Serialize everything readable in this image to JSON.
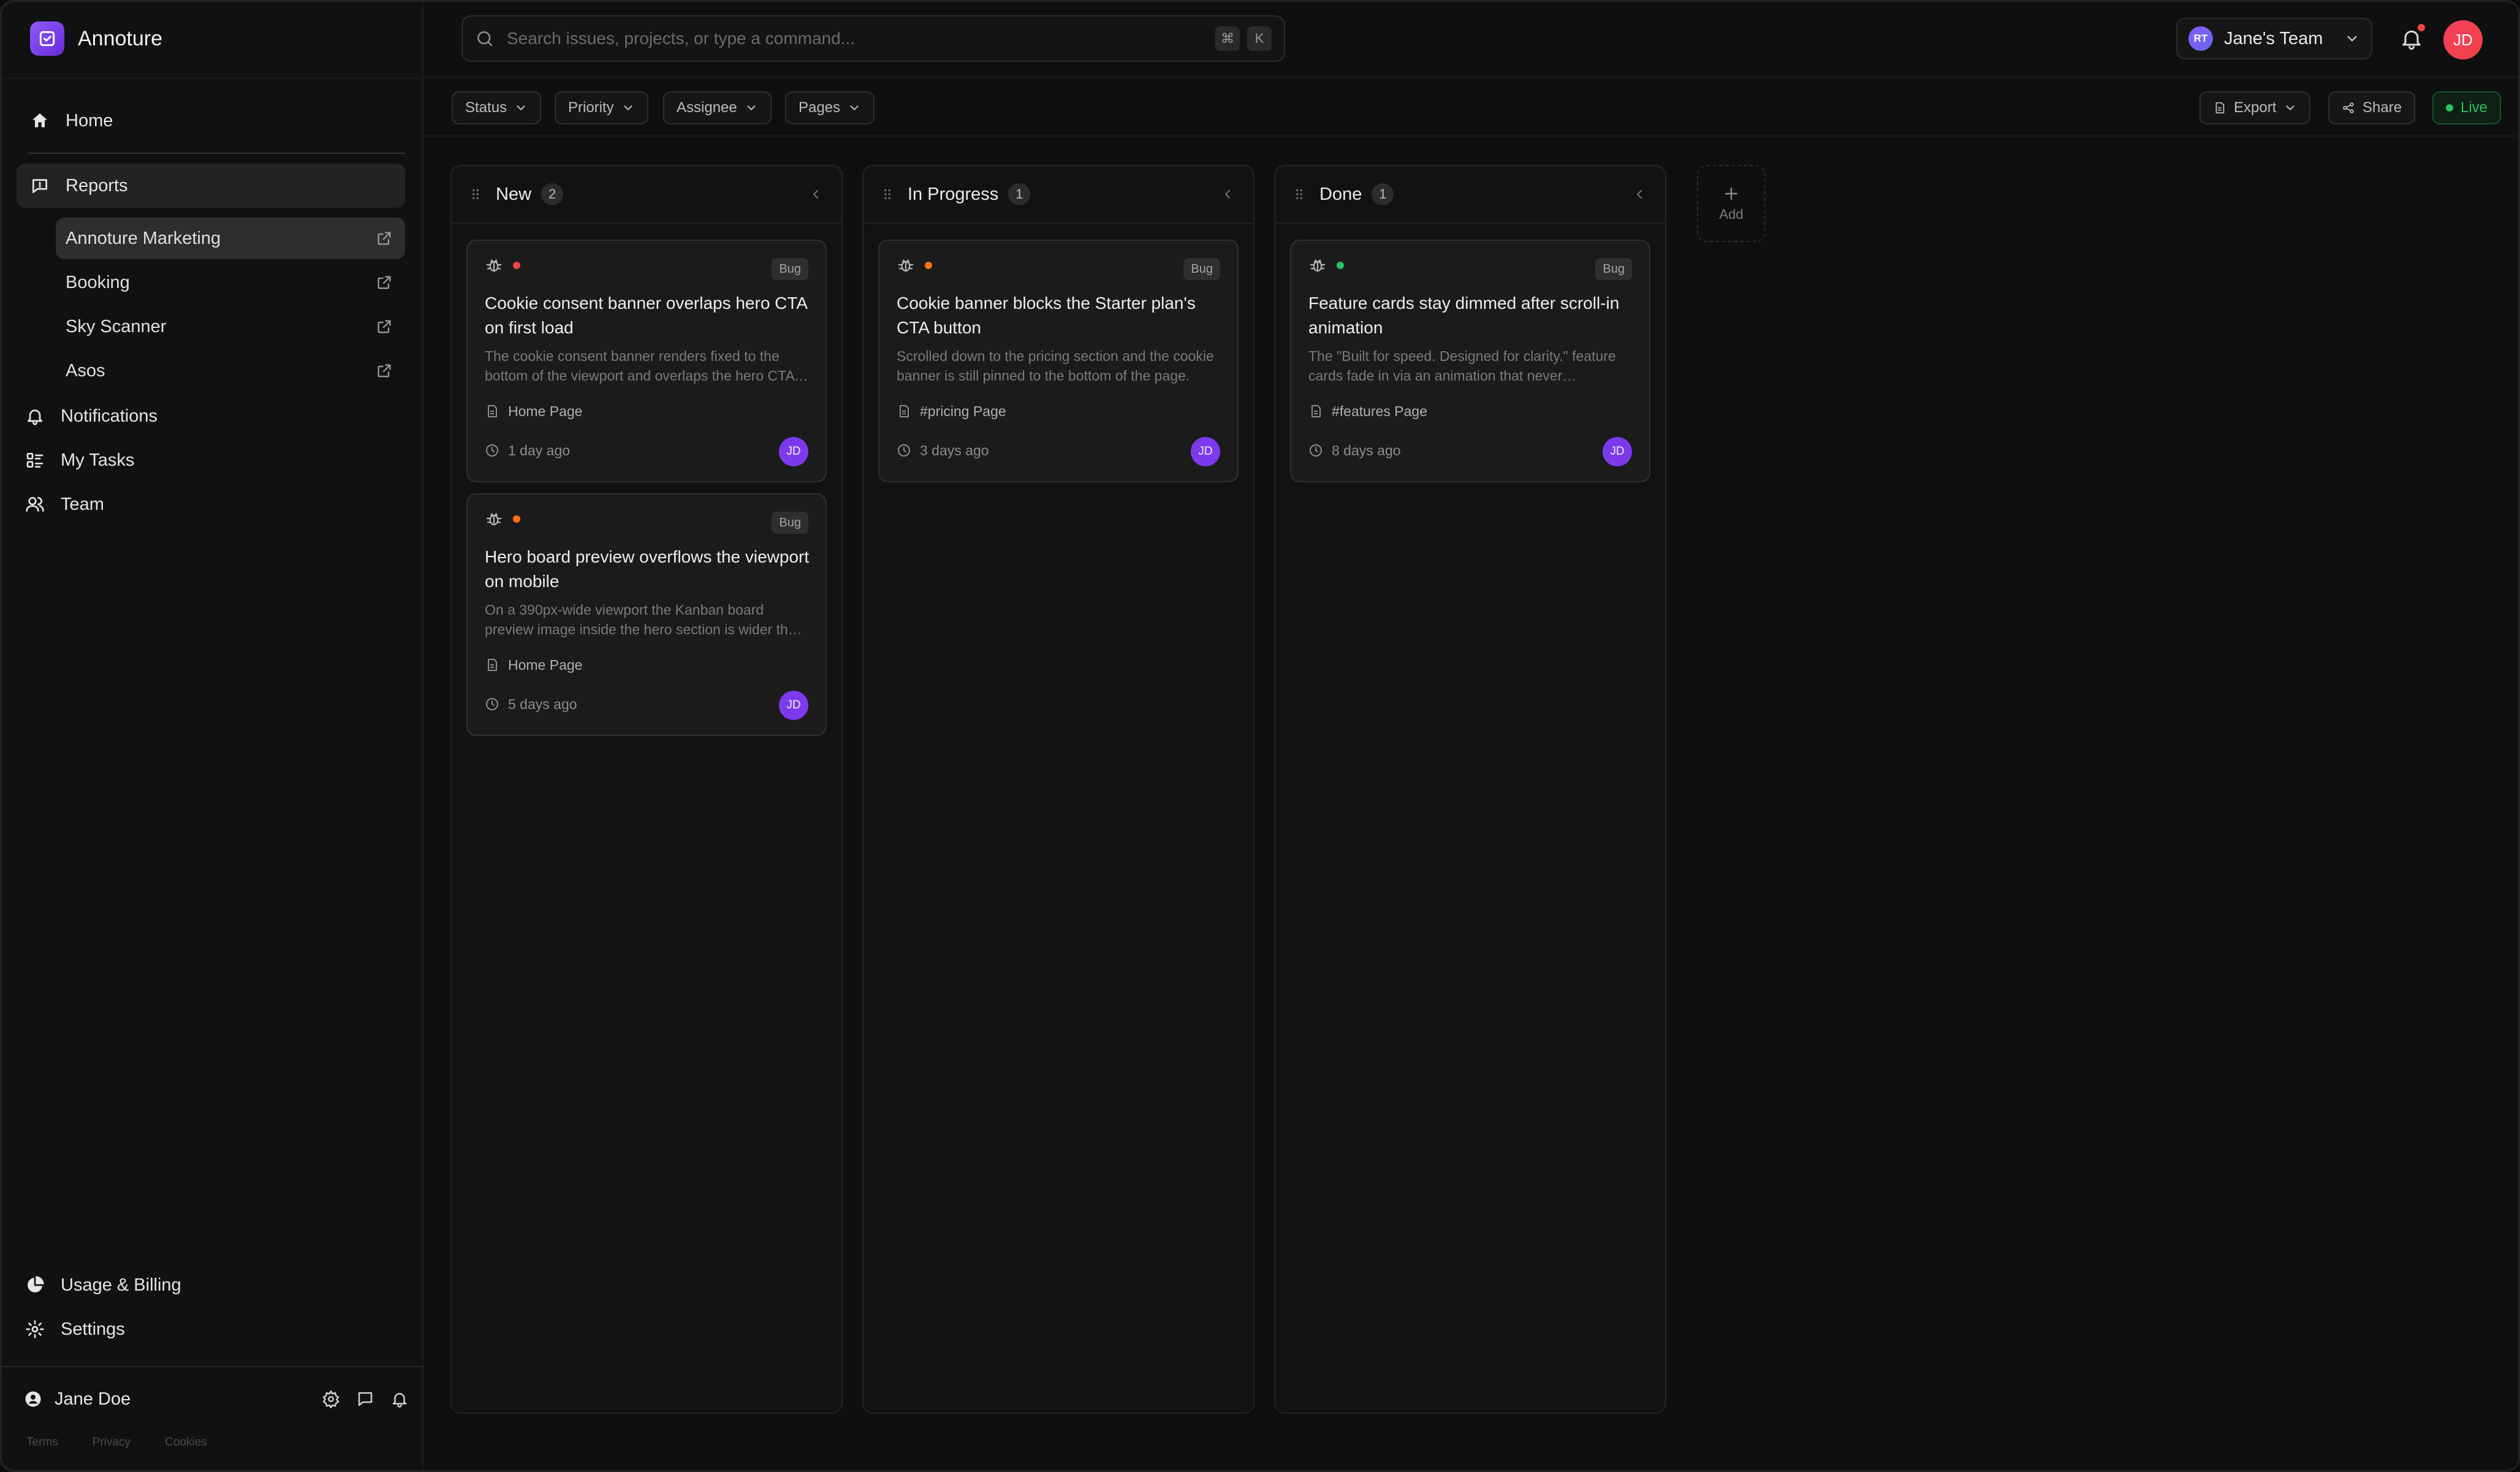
{
  "app": {
    "name": "Annoture",
    "accent": "#7c3aed"
  },
  "sidebar": {
    "home": "Home",
    "reports": "Reports",
    "reports_items": [
      {
        "label": "Annoture Marketing",
        "active": true
      },
      {
        "label": "Booking",
        "active": false
      },
      {
        "label": "Sky Scanner",
        "active": false
      },
      {
        "label": "Asos",
        "active": false
      }
    ],
    "notifications": "Notifications",
    "my_tasks": "My Tasks",
    "team": "Team",
    "usage_billing": "Usage & Billing",
    "settings": "Settings",
    "user": {
      "name": "Jane Doe"
    },
    "legal": {
      "terms": "Terms",
      "privacy": "Privacy",
      "cookies": "Cookies"
    }
  },
  "topbar": {
    "search_placeholder": "Search issues, projects, or type a command...",
    "shortcut": {
      "mod": "⌘",
      "key": "K"
    },
    "team": {
      "badge": "RT",
      "name": "Jane's Team"
    },
    "avatar": "JD",
    "has_unread": true
  },
  "filters": {
    "status": "Status",
    "priority": "Priority",
    "assignee": "Assignee",
    "pages": "Pages",
    "export": "Export",
    "share": "Share",
    "live": "Live"
  },
  "board": {
    "columns": [
      {
        "title": "New",
        "count": "2",
        "cards": [
          {
            "tag": "Bug",
            "dot_color": "#ef4444",
            "title": "Cookie consent banner overlaps hero CTA on first load",
            "desc": "The cookie consent banner renders fixed to the bottom of the viewport and overlaps the hero CTA buttons on first load.",
            "page": "Home Page",
            "time": "1 day ago",
            "assignee": "JD"
          },
          {
            "tag": "Bug",
            "dot_color": "#f97316",
            "title": "Hero board preview overflows the viewport on mobile",
            "desc": "On a 390px-wide viewport the Kanban board preview image inside the hero section is wider than the viewport.",
            "page": "Home Page",
            "time": "5 days ago",
            "assignee": "JD"
          }
        ]
      },
      {
        "title": "In Progress",
        "count": "1",
        "cards": [
          {
            "tag": "Bug",
            "dot_color": "#f97316",
            "title": "Cookie banner blocks the Starter plan's CTA button",
            "desc": "Scrolled down to the pricing section and the cookie banner is still pinned to the bottom of the page.",
            "page": "#pricing Page",
            "time": "3 days ago",
            "assignee": "JD"
          }
        ]
      },
      {
        "title": "Done",
        "count": "1",
        "cards": [
          {
            "tag": "Bug",
            "dot_color": "#22c55e",
            "title": "Feature cards stay dimmed after scroll-in animation",
            "desc": "The \"Built for speed. Designed for clarity.\" feature cards fade in via an animation that never completes.",
            "page": "#features Page",
            "time": "8 days ago",
            "assignee": "JD"
          }
        ]
      }
    ],
    "add_label": "Add"
  }
}
